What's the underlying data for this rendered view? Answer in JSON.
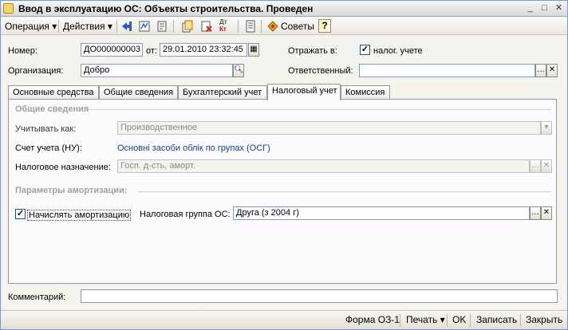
{
  "window": {
    "title": "Ввод в эксплуатацию ОС: Объекты строительства. Проведен"
  },
  "toolbar": {
    "operation": "Операция",
    "actions": "Действия",
    "advice": "Советы",
    "help": "?",
    "dt_kt_top": "Дт",
    "dt_kt_bottom": "Кт"
  },
  "header": {
    "number_label": "Номер:",
    "number_value": "ДО000000003",
    "from_label": "от:",
    "date_value": "29.01.2010 23:32:45",
    "reflect_label": "Отражать в:",
    "tax_check_label": "налог. учете",
    "org_label": "Организация:",
    "org_value": "Добро",
    "responsible_label": "Ответственный:",
    "responsible_value": ""
  },
  "tabs": [
    "Основные средства",
    "Общие сведения",
    "Бухгалтерский учет",
    "Налоговый учет",
    "Комиссия"
  ],
  "tax": {
    "general_section": "Общие сведения",
    "account_as_label": "Учитывать как:",
    "account_as_value": "Производственное",
    "account_label": "Счет учета (НУ):",
    "account_value": "Основні засоби облік по групах  (ОСГ)",
    "purpose_label": "Налоговое назначение:",
    "purpose_value": "Госп. д-сть, аморт.",
    "amort_section": "Параметры амортизации:",
    "accrue_label": "Начислять амортизацию",
    "group_label": "Налоговая группа ОС:",
    "group_value": "Друга (з 2004 г)"
  },
  "comment": {
    "label": "Комментарий:",
    "value": ""
  },
  "bottom": {
    "form": "Форма ОЗ-1",
    "print": "Печать",
    "ok": "OK",
    "save": "Записать",
    "close": "Закрыть"
  }
}
